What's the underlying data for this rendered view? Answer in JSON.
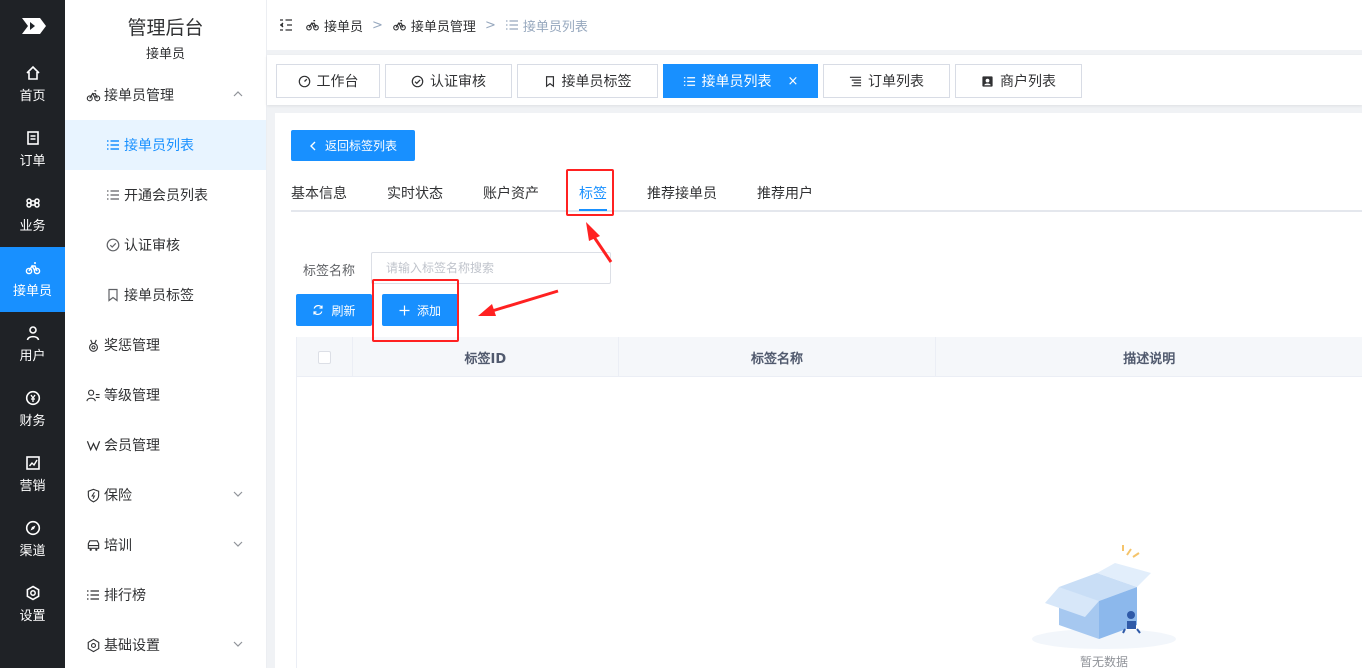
{
  "rail": {
    "items": [
      {
        "label": "首页",
        "icon": "home-icon"
      },
      {
        "label": "订单",
        "icon": "order-icon"
      },
      {
        "label": "业务",
        "icon": "command-icon"
      },
      {
        "label": "接单员",
        "icon": "bicycle-icon"
      },
      {
        "label": "用户",
        "icon": "user-icon"
      },
      {
        "label": "财务",
        "icon": "finance-icon"
      },
      {
        "label": "营销",
        "icon": "chart-icon"
      },
      {
        "label": "渠道",
        "icon": "compass-icon"
      },
      {
        "label": "设置",
        "icon": "settings-icon"
      }
    ]
  },
  "sidebar": {
    "title": "管理后台",
    "subtitle": "接单员",
    "items": [
      {
        "label": "接单员管理"
      },
      {
        "label": "接单员列表"
      },
      {
        "label": "开通会员列表"
      },
      {
        "label": "认证审核"
      },
      {
        "label": "接单员标签"
      },
      {
        "label": "奖惩管理"
      },
      {
        "label": "等级管理"
      },
      {
        "label": "会员管理"
      },
      {
        "label": "保险"
      },
      {
        "label": "培训"
      },
      {
        "label": "排行榜"
      },
      {
        "label": "基础设置"
      }
    ]
  },
  "breadcrumb": {
    "items": [
      "接单员",
      "接单员管理",
      "接单员列表"
    ]
  },
  "tags": [
    "工作台",
    "认证审核",
    "接单员标签",
    "接单员列表",
    "订单列表",
    "商户列表"
  ],
  "main": {
    "back_label": "返回标签列表",
    "tabs": [
      "基本信息",
      "实时状态",
      "账户资产",
      "标签",
      "推荐接单员",
      "推荐用户"
    ],
    "search_label": "标签名称",
    "search_placeholder": "请输入标签名称搜索",
    "refresh_label": "刷新",
    "add_label": "添加",
    "columns": [
      "标签ID",
      "标签名称",
      "描述说明"
    ],
    "empty_text": "暂无数据"
  },
  "colors": {
    "primary": "#1890ff",
    "rail": "#1f2226",
    "annotation": "#ff2121"
  }
}
